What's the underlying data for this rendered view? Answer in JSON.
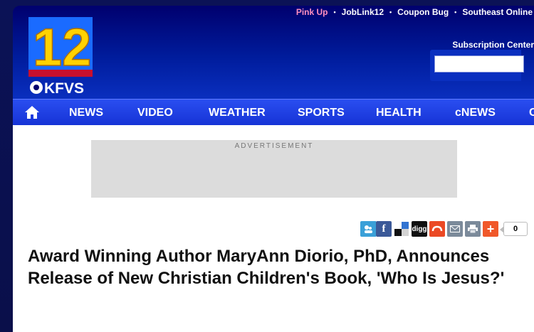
{
  "header": {
    "logo_number": "12",
    "logo_call_sign": "KFVS",
    "top_links": [
      {
        "label": "Pink Up",
        "color": "#ff8fbf"
      },
      {
        "label": "JobLink12",
        "color": "#ffffff"
      },
      {
        "label": "Coupon Bug",
        "color": "#ffffff"
      },
      {
        "label": "Southeast Online",
        "color": "#ffffff"
      }
    ],
    "link_separator": "•",
    "subscription_center": "Subscription Center",
    "search_placeholder": ""
  },
  "nav": {
    "home_icon": "home-icon",
    "items": [
      "NEWS",
      "VIDEO",
      "WEATHER",
      "SPORTS",
      "HEALTH",
      "cNEWS",
      "C"
    ]
  },
  "ad": {
    "label": "ADVERTISEMENT"
  },
  "share": {
    "icons": [
      "myspace-icon",
      "facebook-icon",
      "delicious-icon",
      "digg-icon",
      "stumbleupon-icon",
      "email-icon",
      "print-icon",
      "addthis-icon"
    ],
    "digg_label": "digg",
    "count": "0"
  },
  "article": {
    "headline": "Award Winning Author MaryAnn Diorio, PhD, Announces Release of New Christian Children's Book, 'Who Is Jesus?'"
  },
  "colors": {
    "header_dark": "#00006e",
    "nav_blue": "#1633d6",
    "pink_link": "#ff8fbf"
  }
}
